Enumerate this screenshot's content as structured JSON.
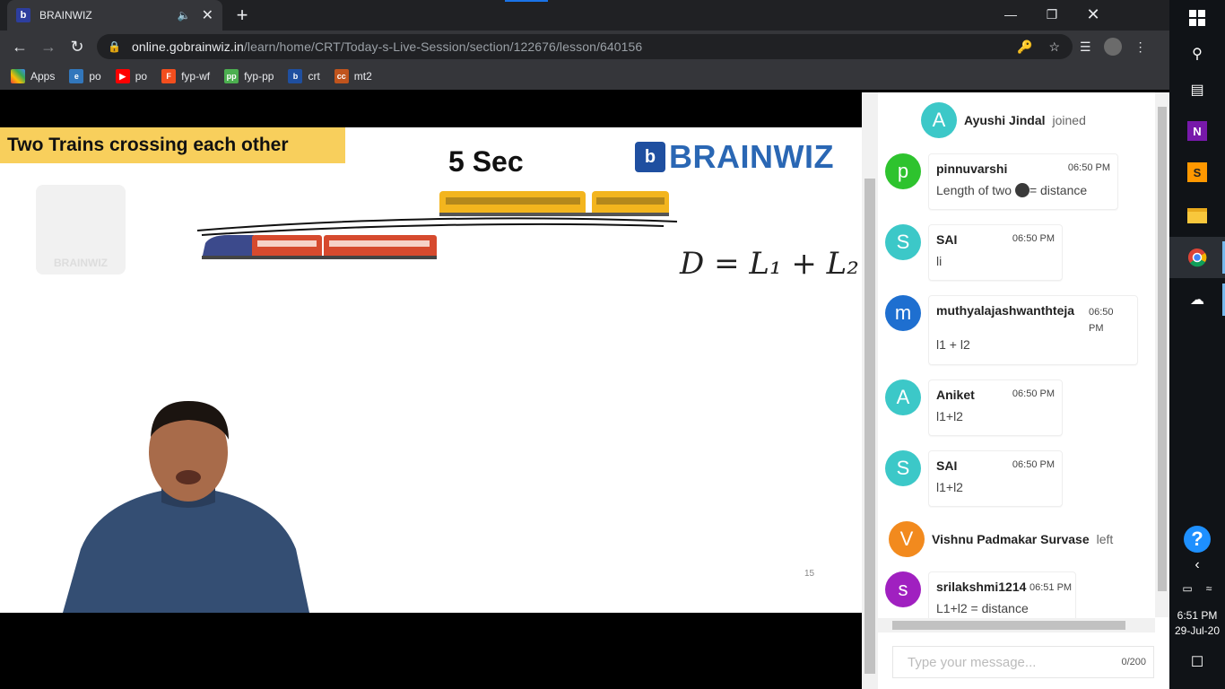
{
  "browser": {
    "tab_title": "BRAINWIZ",
    "tab_favicon": "b",
    "new_tab": "+",
    "url_domain": "online.gobrainwiz.in",
    "url_path": "/learn/home/CRT/Today-s-Live-Session/section/122676/lesson/640156",
    "bookmarks": [
      {
        "label": "Apps",
        "icon": "apps-grid-icon",
        "color": "#e8453c"
      },
      {
        "label": "po",
        "icon": "edge-icon",
        "color": "#3277bc"
      },
      {
        "label": "po",
        "icon": "youtube-icon",
        "color": "#ff0000"
      },
      {
        "label": "fyp-wf",
        "icon": "figma-icon",
        "color": "#f24e1e"
      },
      {
        "label": "fyp-pp",
        "icon": "pp-icon",
        "color": "#4caf50"
      },
      {
        "label": "crt",
        "icon": "brainwiz-icon",
        "color": "#1f4fa0"
      },
      {
        "label": "mt2",
        "icon": "cc-icon",
        "color": "#c0541d"
      }
    ]
  },
  "slide": {
    "title": "Two Trains crossing each other",
    "time_label": "5 Sec",
    "brand_name": "BRAINWIZ",
    "watermark": "BRAINWIZ",
    "formula": "D = L₁ + L₂",
    "page_number": "15"
  },
  "chat": {
    "events": [
      {
        "type": "system",
        "initial": "A",
        "name": "Ayushi Jindal",
        "action": "joined",
        "color": "#3cc8c8"
      },
      {
        "type": "message",
        "initial": "p",
        "user": "pinnuvarshi",
        "time": "06:50 PM",
        "text_before": "Length of two ",
        "text_after": "= distance",
        "color": "#2ec32e"
      },
      {
        "type": "message",
        "initial": "S",
        "user": "SAI",
        "time": "06:50 PM",
        "text": "li",
        "color": "#3cc8c8"
      },
      {
        "type": "message",
        "initial": "m",
        "user": "muthyalajashwanthteja",
        "time": "06:50 PM",
        "text": "l1 + l2",
        "color": "#1e6fd0"
      },
      {
        "type": "message",
        "initial": "A",
        "user": "Aniket",
        "time": "06:50 PM",
        "text": "l1+l2",
        "color": "#3cc8c8"
      },
      {
        "type": "message",
        "initial": "S",
        "user": "SAI",
        "time": "06:50 PM",
        "text": "l1+l2",
        "color": "#3cc8c8"
      },
      {
        "type": "system",
        "initial": "V",
        "name": "Vishnu Padmakar Survase",
        "action": "left",
        "color": "#f28a1e"
      },
      {
        "type": "message",
        "initial": "s",
        "user": "srilakshmi1214",
        "time": "06:51 PM",
        "text": "L1+l2 = distance",
        "color": "#a020c0"
      }
    ],
    "input_placeholder": "Type your message...",
    "char_count": "0/200"
  },
  "taskbar": {
    "time": "6:51 PM",
    "date": "29-Jul-20",
    "help": "?"
  }
}
